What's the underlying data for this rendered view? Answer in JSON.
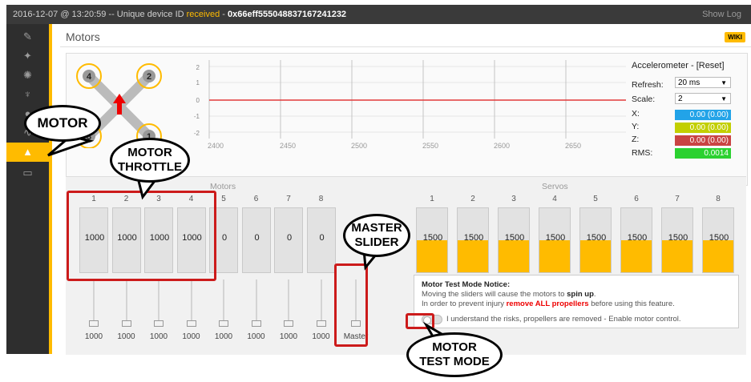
{
  "topbar": {
    "timestamp": "2016-12-07 @ 13:20:59 -- Unique device ID",
    "received": "received",
    "device_id": "0x66eff555048837167241232",
    "show_log": "Show Log"
  },
  "sidebar": {
    "items": [
      {
        "icon": "wrench-icon",
        "glyph": "✎"
      },
      {
        "icon": "plug-icon",
        "glyph": "✦"
      },
      {
        "icon": "gear-icon",
        "glyph": "✺"
      },
      {
        "icon": "network-icon",
        "glyph": "♆"
      },
      {
        "icon": "sensor-icon",
        "glyph": "●"
      },
      {
        "icon": "wave-icon",
        "glyph": "∿"
      },
      {
        "icon": "motor-icon",
        "glyph": "▲"
      },
      {
        "icon": "window-icon",
        "glyph": "▭"
      }
    ]
  },
  "page": {
    "title": "Motors",
    "wiki": "WIKI"
  },
  "diagram": {
    "motor_labels": [
      "4",
      "2",
      "3",
      "1"
    ]
  },
  "graph": {
    "y_ticks": [
      "2",
      "1",
      "0",
      "-1",
      "-2"
    ],
    "x_ticks": [
      "2400",
      "2450",
      "2500",
      "2550",
      "2600",
      "2650"
    ]
  },
  "accelerometer": {
    "title": "Accelerometer - [Reset]",
    "refresh_label": "Refresh:",
    "refresh_value": "20 ms",
    "scale_label": "Scale:",
    "scale_value": "2",
    "x_label": "X:",
    "x_value": "0.00 (0.00)",
    "x_color": "#22a3e8",
    "y_label": "Y:",
    "y_value": "0.00 (0.00)",
    "y_color": "#c2cf00",
    "z_label": "Z:",
    "z_value": "0.00 (0.00)",
    "z_color": "#c94343",
    "rms_label": "RMS:",
    "rms_value": "0.0014",
    "rms_color": "#2bd130"
  },
  "motors": {
    "label": "Motors",
    "numbers": [
      "1",
      "2",
      "3",
      "4",
      "5",
      "6",
      "7",
      "8"
    ],
    "values": [
      "1000",
      "1000",
      "1000",
      "1000",
      "0",
      "0",
      "0",
      "0"
    ],
    "slider_values": [
      "1000",
      "1000",
      "1000",
      "1000",
      "1000",
      "1000",
      "1000",
      "1000"
    ],
    "master_label": "Master"
  },
  "servos": {
    "label": "Servos",
    "numbers": [
      "1",
      "2",
      "3",
      "4",
      "5",
      "6",
      "7",
      "8"
    ],
    "values": [
      "1500",
      "1500",
      "1500",
      "1500",
      "1500",
      "1500",
      "1500",
      "1500"
    ],
    "level": 0.5
  },
  "notice": {
    "title": "Motor Test Mode Notice:",
    "line1_a": "Moving the sliders will cause the motors to ",
    "line1_b": "spin up",
    "line1_c": ".",
    "line2_a": "In order to prevent injury ",
    "line2_b": "remove ALL propellers",
    "line2_c": " before using this feature.",
    "ack": "I understand the risks, propellers are removed - Enable motor control."
  },
  "callouts": {
    "motor": "MOTOR",
    "throttle_1": "MOTOR",
    "throttle_2": "THROTTLE",
    "master_1": "MASTER",
    "master_2": "SLIDER",
    "test_1": "MOTOR",
    "test_2": "TEST MODE"
  },
  "colors": {
    "accent": "#ffbb00",
    "annotation": "#cc1b1b"
  }
}
